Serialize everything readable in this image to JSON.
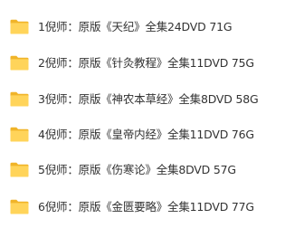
{
  "folders": [
    {
      "name": "1倪师：原版《天纪》全集24DVD  71G",
      "icon": "folder-icon"
    },
    {
      "name": "2倪师：原版《针灸教程》全集11DVD  75G",
      "icon": "folder-icon"
    },
    {
      "name": "3倪师：原版《神农本草经》全集8DVD  58G",
      "icon": "folder-icon"
    },
    {
      "name": "4倪师：原版《皇帝内经》全集11DVD  76G",
      "icon": "folder-icon"
    },
    {
      "name": "5倪师：原版《伤寒论》全集8DVD  57G",
      "icon": "folder-icon"
    },
    {
      "name": "6倪师：原版《金匮要略》全集11DVD  77G",
      "icon": "folder-icon"
    }
  ],
  "colors": {
    "folder_back": "#f0b429",
    "folder_front": "#ffd45a",
    "text": "#333333"
  }
}
